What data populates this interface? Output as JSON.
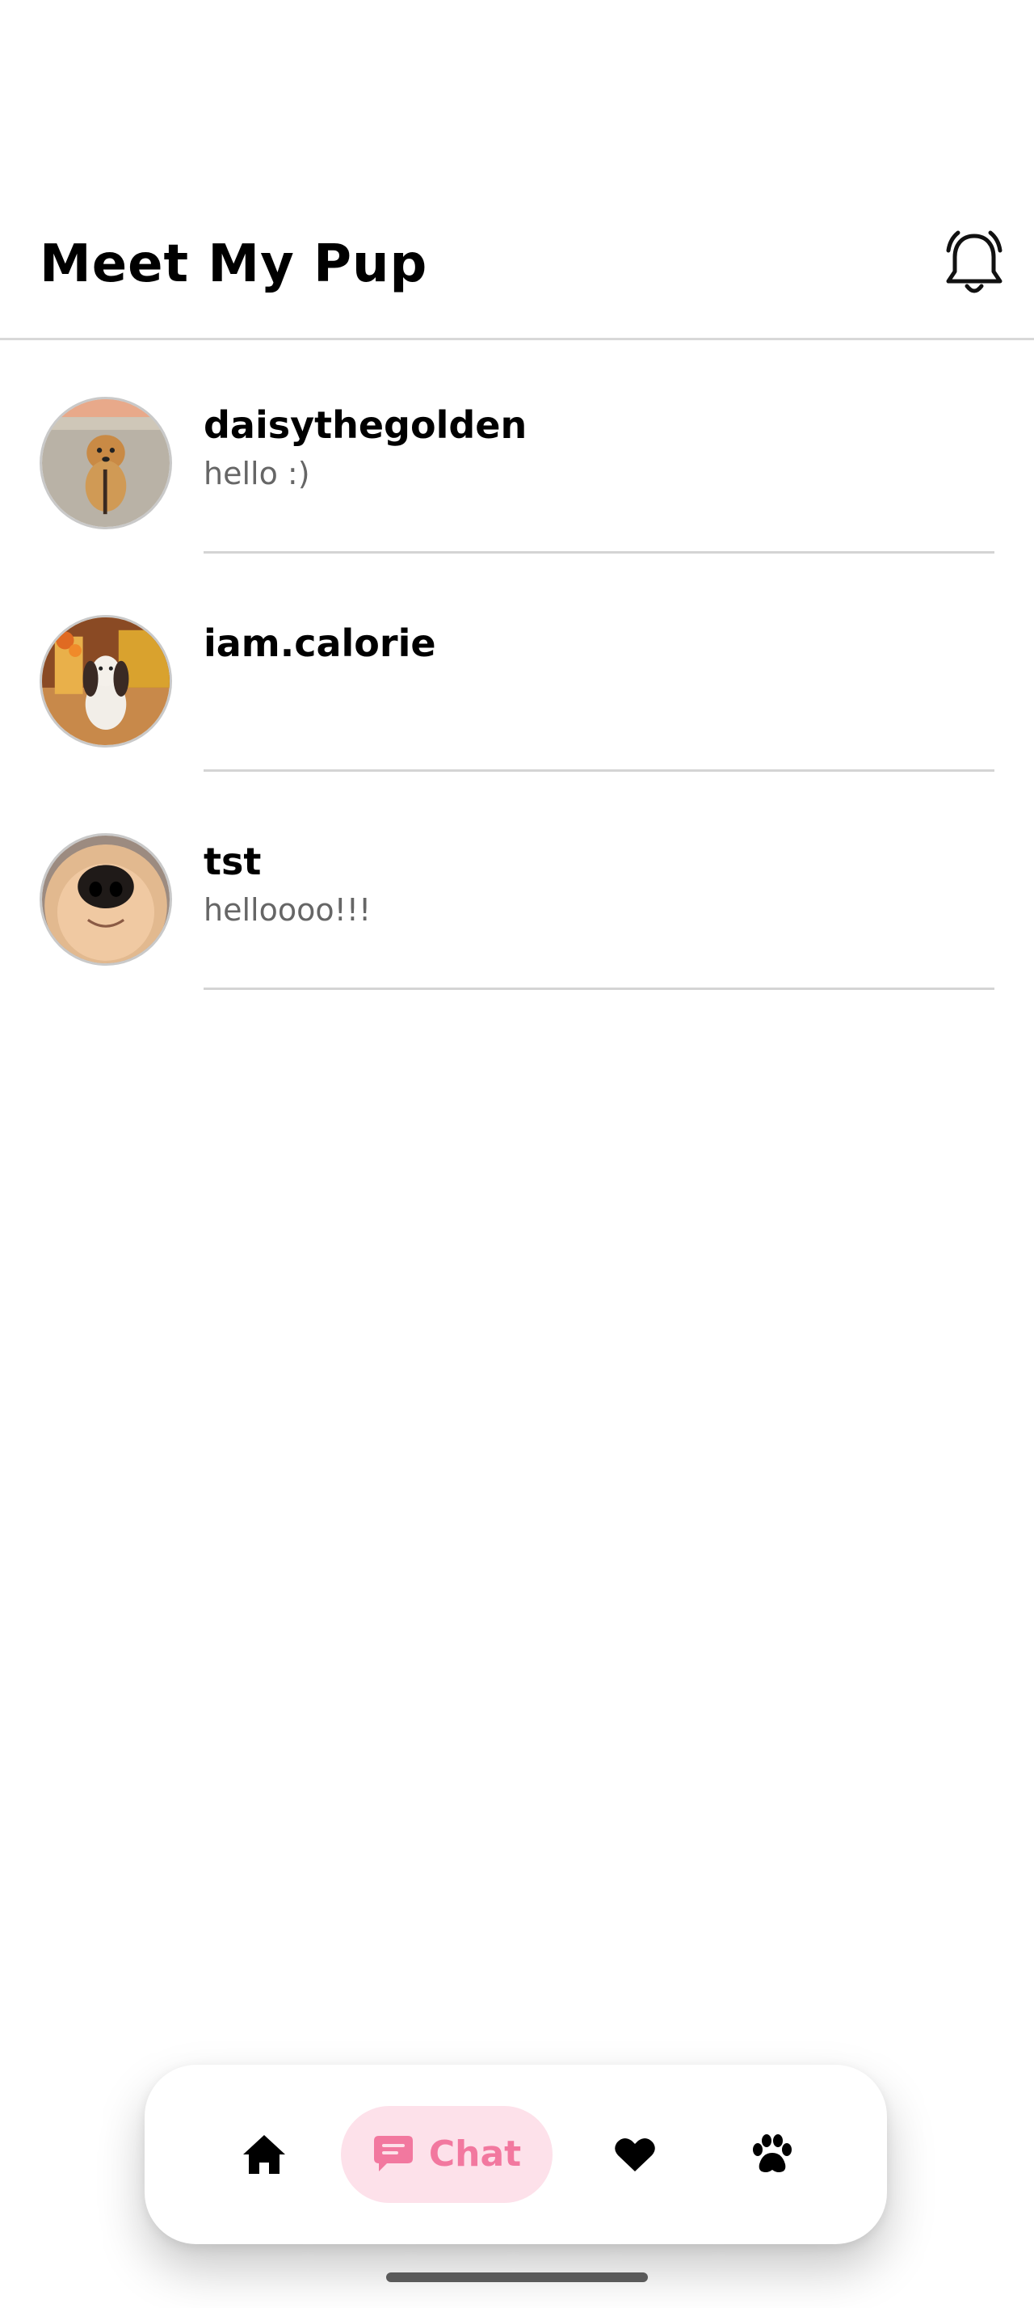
{
  "header": {
    "title": "Meet My Pup",
    "notification_icon": "bell-icon"
  },
  "chats": [
    {
      "name": "daisythegolden",
      "preview": "hello :)",
      "avatar": "golden-retriever-on-beach-photo"
    },
    {
      "name": "iam.calorie",
      "preview": "",
      "avatar": "spaniel-dog-indoors-photo"
    },
    {
      "name": "tst",
      "preview": "helloooo!!!",
      "avatar": "dog-nose-closeup-photo"
    }
  ],
  "nav": {
    "items": [
      {
        "icon": "home-icon",
        "label": ""
      },
      {
        "icon": "chat-icon",
        "label": "Chat",
        "active": true
      },
      {
        "icon": "heart-icon",
        "label": ""
      },
      {
        "icon": "paw-icon",
        "label": ""
      }
    ],
    "active_color": "#f2789f",
    "active_bg": "#fde1ea"
  }
}
